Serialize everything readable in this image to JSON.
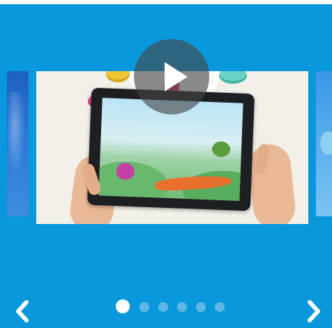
{
  "carousel": {
    "slides": [
      {
        "label": "",
        "active": false
      },
      {
        "label": "",
        "active": true
      },
      {
        "label": "",
        "active": false
      }
    ],
    "pagination": {
      "count": 6,
      "active_index": 0
    },
    "icons": {
      "prev": "chevron-left-icon",
      "next": "chevron-right-icon",
      "play": "play-icon"
    },
    "colors": {
      "background": "#0a98dc",
      "dot_active": "#ffffff",
      "dot_inactive": "#5fb7e6"
    }
  }
}
